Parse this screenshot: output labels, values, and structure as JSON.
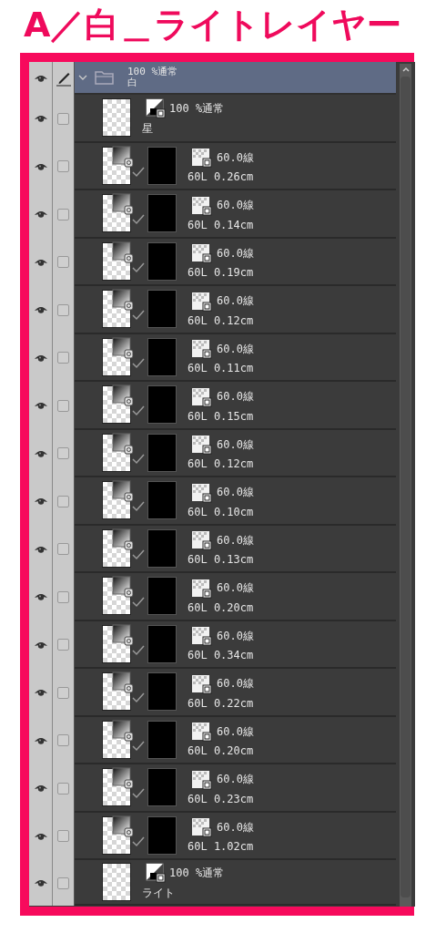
{
  "title": "A／白＿ライトレイヤー",
  "folder": {
    "mode": "100 %通常",
    "name": "白",
    "expanded": true,
    "selected": true,
    "visible": true,
    "editing": true
  },
  "layers": [
    {
      "kind": "raster",
      "mode": "100 %通常",
      "name": "星",
      "visible": true,
      "editing": false
    },
    {
      "kind": "vector",
      "mode": "60.0線",
      "info": "60L 0.26cm",
      "visible": true,
      "editing": false
    },
    {
      "kind": "vector",
      "mode": "60.0線",
      "info": "60L 0.14cm",
      "visible": true,
      "editing": false
    },
    {
      "kind": "vector",
      "mode": "60.0線",
      "info": "60L 0.19cm",
      "visible": true,
      "editing": false
    },
    {
      "kind": "vector",
      "mode": "60.0線",
      "info": "60L 0.12cm",
      "visible": true,
      "editing": false
    },
    {
      "kind": "vector",
      "mode": "60.0線",
      "info": "60L 0.11cm",
      "visible": true,
      "editing": false
    },
    {
      "kind": "vector",
      "mode": "60.0線",
      "info": "60L 0.15cm",
      "visible": true,
      "editing": false
    },
    {
      "kind": "vector",
      "mode": "60.0線",
      "info": "60L 0.12cm",
      "visible": true,
      "editing": false
    },
    {
      "kind": "vector",
      "mode": "60.0線",
      "info": "60L 0.10cm",
      "visible": true,
      "editing": false
    },
    {
      "kind": "vector",
      "mode": "60.0線",
      "info": "60L 0.13cm",
      "visible": true,
      "editing": false
    },
    {
      "kind": "vector",
      "mode": "60.0線",
      "info": "60L 0.20cm",
      "visible": true,
      "editing": false
    },
    {
      "kind": "vector",
      "mode": "60.0線",
      "info": "60L 0.34cm",
      "visible": true,
      "editing": false
    },
    {
      "kind": "vector",
      "mode": "60.0線",
      "info": "60L 0.22cm",
      "visible": true,
      "editing": false
    },
    {
      "kind": "vector",
      "mode": "60.0線",
      "info": "60L 0.20cm",
      "visible": true,
      "editing": false
    },
    {
      "kind": "vector",
      "mode": "60.0線",
      "info": "60L 0.23cm",
      "visible": true,
      "editing": false
    },
    {
      "kind": "vector",
      "mode": "60.0線",
      "info": "60L 1.02cm",
      "visible": true,
      "editing": false
    },
    {
      "kind": "raster",
      "mode": "100 %通常",
      "name": "ライト",
      "visible": true,
      "editing": false
    }
  ]
}
